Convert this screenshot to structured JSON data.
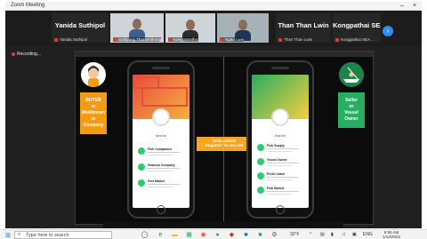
{
  "window": {
    "title": "Zoom Meeting",
    "minimize": "–",
    "close": "×"
  },
  "participants": [
    {
      "name": "Yanida Suthipol",
      "sub": "Yanida Suthipol"
    },
    {
      "name": "",
      "sub": "Suttipong Thanamthong"
    },
    {
      "name": "",
      "sub": "Kongpatrathsi"
    },
    {
      "name": "",
      "sub": "Ngao Lwin"
    },
    {
      "name": "Than Than Lwin",
      "sub": "Than Than Lwin"
    },
    {
      "name": "Kongpathai SEA...",
      "sub": "Kongpathai SEA..."
    }
  ],
  "next_button": "›",
  "recording": "Recording...",
  "slide": {
    "left_role": "BUYER\nor\nMiddleman\nor\nCompany",
    "right_role": "Seller\nor\nVessel\nOwner",
    "arrow_text": "SEND ORDER\nREQUEST TO SELLER",
    "left_phone": {
      "section": "Market",
      "rows": [
        "Fish Companies",
        "Seafood Company",
        "Port Market"
      ]
    },
    "right_phone": {
      "section": "Market",
      "rows": [
        "Fish Supply",
        "Vessel Owner",
        "Fresh Catch",
        "Fish Market"
      ]
    }
  },
  "taskbar": {
    "start": "⊞",
    "search_placeholder": "Type here to search",
    "weather": "32°F",
    "lang": "ENG",
    "time": "9:55 AM",
    "date": "1/13/2022"
  }
}
